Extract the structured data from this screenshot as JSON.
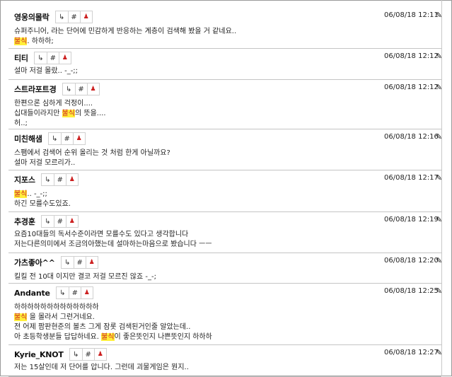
{
  "ui": {
    "buttons": {
      "reply": "↳",
      "hash": "#",
      "report": "♟"
    },
    "edit_icon": "✎"
  },
  "comments": [
    {
      "author": "영웅의몰락",
      "date": "06/08/18 12:11",
      "lines": [
        [
          {
            "t": "슈퍼주니어, 라는 단어에 민감하게 반응하는 계층이 검색해 봤을 거 같네요.."
          }
        ],
        [
          {
            "t": "불식",
            "hl": true
          },
          {
            "t": ". 하하하;"
          }
        ]
      ]
    },
    {
      "author": "티티",
      "date": "06/08/18 12:12",
      "lines": [
        [
          {
            "t": "설마 저걸 몰랐.. -_-;;"
          }
        ]
      ]
    },
    {
      "author": "스트라포트경",
      "date": "06/08/18 12:12",
      "lines": [
        [
          {
            "t": "한편으론 심하게 걱정이...."
          }
        ],
        [
          {
            "t": "십대들이라지만 "
          },
          {
            "t": "불식",
            "hl": true
          },
          {
            "t": "의 뜻을...."
          }
        ],
        [
          {
            "t": "허..;"
          }
        ]
      ]
    },
    {
      "author": "미친해샘",
      "date": "06/08/18 12:16",
      "lines": [
        [
          {
            "t": "스팸에서 검색어 순위 올리는 것 처럼 한게 아닐까요?"
          }
        ],
        [
          {
            "t": "설마 저걸 모르리가.."
          }
        ]
      ]
    },
    {
      "author": "지포스",
      "date": "06/08/18 12:17",
      "lines": [
        [
          {
            "t": "불식",
            "hl": true
          },
          {
            "t": ".. -_-;;"
          }
        ],
        [
          {
            "t": "하긴 모를수도있죠."
          }
        ]
      ]
    },
    {
      "author": "추경훈",
      "date": "06/08/18 12:19",
      "lines": [
        [
          {
            "t": "요즘10대들의 독서수준이라면 모를수도 있다고 생각합니다"
          }
        ],
        [
          {
            "t": "저는다른의미에서 조금의아했는데 설마하는마음으로 봤습니다 ㅡㅡ"
          }
        ]
      ]
    },
    {
      "author": "가츠좋아^^",
      "date": "06/08/18 12:20",
      "lines": [
        [
          {
            "t": "킬킬 전 10대 이지만 결코 저걸 모르진 않죠 -_-;"
          }
        ]
      ]
    },
    {
      "author": "Andante",
      "date": "06/08/18 12:25",
      "lines": [
        [
          {
            "t": "하하하하하하하하하하하하하"
          }
        ],
        [
          {
            "t": "불식",
            "hl": true
          },
          {
            "t": " 을 몰라서 그런거네요."
          }
        ],
        [
          {
            "t": "전 어제 팜판현준의 볼츠 그게 잠롯 검색된거인줄 알았는데.."
          }
        ],
        [
          {
            "t": "아 초등학생분들 답답하네요. "
          },
          {
            "t": "불식",
            "hl": true
          },
          {
            "t": "이 좋은뜻인지 나쁜뜻인지 하하하"
          }
        ]
      ]
    },
    {
      "author": "Kyrie_KNOT",
      "date": "06/08/18 12:27",
      "lines": [
        [
          {
            "t": "저는 15살인데 저 단어를 압니다. 그런데 괴물게임은 뭔지.."
          }
        ]
      ]
    }
  ]
}
